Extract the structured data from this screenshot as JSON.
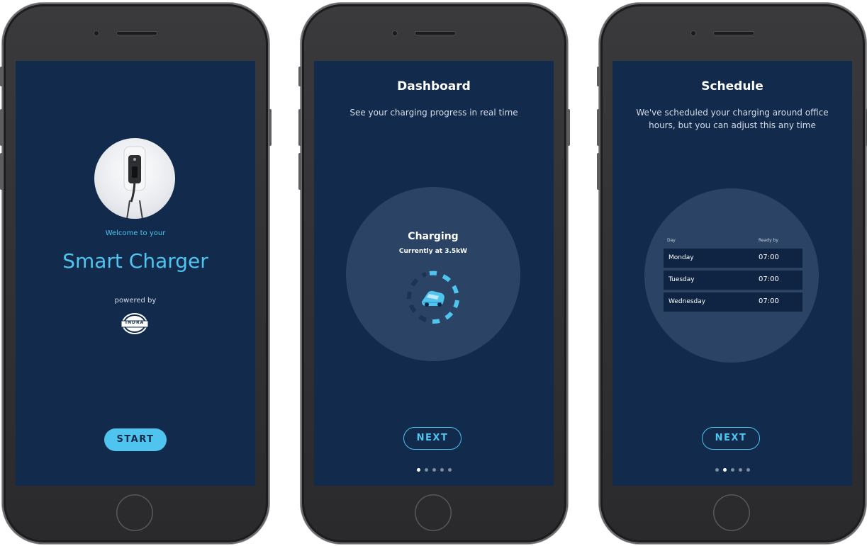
{
  "colors": {
    "screen_bg": "#122a4c",
    "accent": "#4fc4ee",
    "circle_bg": "#2b4465"
  },
  "welcome_screen": {
    "welcome_text": "Welcome to your",
    "product_name": "Smart Charger",
    "powered_by": "powered by",
    "brand_logo_text": "INDRA",
    "start_label": "START",
    "image": "wall-charger-photo"
  },
  "dashboard_screen": {
    "title": "Dashboard",
    "subtitle": "See your charging progress in real time",
    "status_title": "Charging",
    "status_detail": "Currently at 3.5kW",
    "icon": "car-icon",
    "next_label": "NEXT",
    "pagination": {
      "total": 5,
      "active": 1
    }
  },
  "schedule_screen": {
    "title": "Schedule",
    "subtitle": "We've scheduled your charging around office hours, but you can adjust this any time",
    "table": {
      "headers": [
        "Day",
        "Ready by"
      ],
      "rows": [
        {
          "day": "Monday",
          "time": "07:00"
        },
        {
          "day": "Tuesday",
          "time": "07:00"
        },
        {
          "day": "Wednesday",
          "time": "07:00"
        }
      ]
    },
    "next_label": "NEXT",
    "pagination": {
      "total": 5,
      "active": 2
    }
  }
}
